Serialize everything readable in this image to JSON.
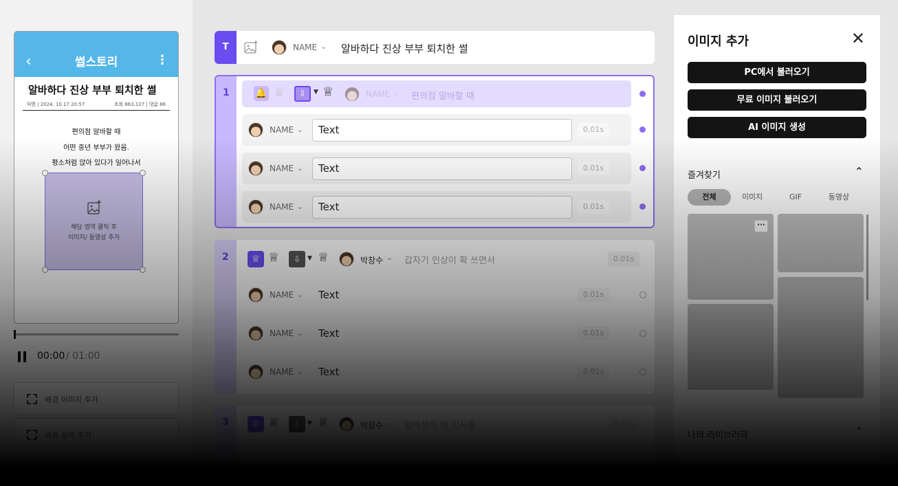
{
  "phone": {
    "header_title": "썰스토리",
    "back_icon": "chevron-left-icon",
    "more_icon": "more-vertical-icon",
    "post_title": "알바하다 진상 부부 퇴치한 썰",
    "meta_left": "익명 | 2024. 10.17 20:57",
    "meta_right": "조회 863,127 | 댓글 86",
    "body_lines": [
      "편의점 알바할 때",
      "어떤 중년 부부가 왔음.",
      "평소처럼 앉아 있다가 일어나서"
    ],
    "drop_zone_text": [
      "해당 영역 클릭 후",
      "이미지/ 동영상 추가"
    ],
    "accent": "#55b6ea"
  },
  "player": {
    "current_time": "00:00",
    "total_time": "/ 01:00",
    "progress": 0
  },
  "side_buttons": [
    {
      "label": "배경 이미지 추가"
    },
    {
      "label": "배경 음악 추가"
    }
  ],
  "title_row": {
    "badge": "T",
    "name": "NAME",
    "title": "알바하다 진상 부부 퇴치한 썰"
  },
  "scenes": [
    {
      "num": "1",
      "head": {
        "name": "NAME",
        "text": "편의점 알바할 때"
      },
      "rows": [
        {
          "name": "NAME",
          "text": "Text",
          "duration": "0.01s"
        },
        {
          "name": "NAME",
          "text": "Text",
          "duration": "0.01s"
        },
        {
          "name": "NAME",
          "text": "Text",
          "duration": "0.01s"
        }
      ]
    },
    {
      "num": "2",
      "head": {
        "name": "박창수",
        "text": "갑자기 인상이 확 쓰면서",
        "duration": "0.01s"
      },
      "rows": [
        {
          "name": "NAME",
          "text": "Text",
          "duration": "0.01s"
        },
        {
          "name": "NAME",
          "text": "Text",
          "duration": "0.01s"
        },
        {
          "name": "NAME",
          "text": "Text",
          "duration": "0.01s"
        }
      ]
    },
    {
      "num": "3",
      "head": {
        "name": "박창수",
        "text": "알바생이 왜 인사를",
        "duration": "0.01s"
      }
    }
  ],
  "panel": {
    "title": "이미지 추가",
    "buttons": [
      "PC에서 불러오기",
      "무료 이미지 불러오기",
      "AI 이미지 생성"
    ],
    "favorites_title": "즐겨찾기",
    "tabs": [
      "전체",
      "이미지",
      "GIF",
      "동영상"
    ],
    "active_tab": "전체",
    "more_label": "···",
    "library_title": "나의 라이브러리"
  },
  "colors": {
    "accent": "#6a4df0",
    "scene_active_bg": "#c7b8ff",
    "active_border": "#8c6cf0"
  }
}
